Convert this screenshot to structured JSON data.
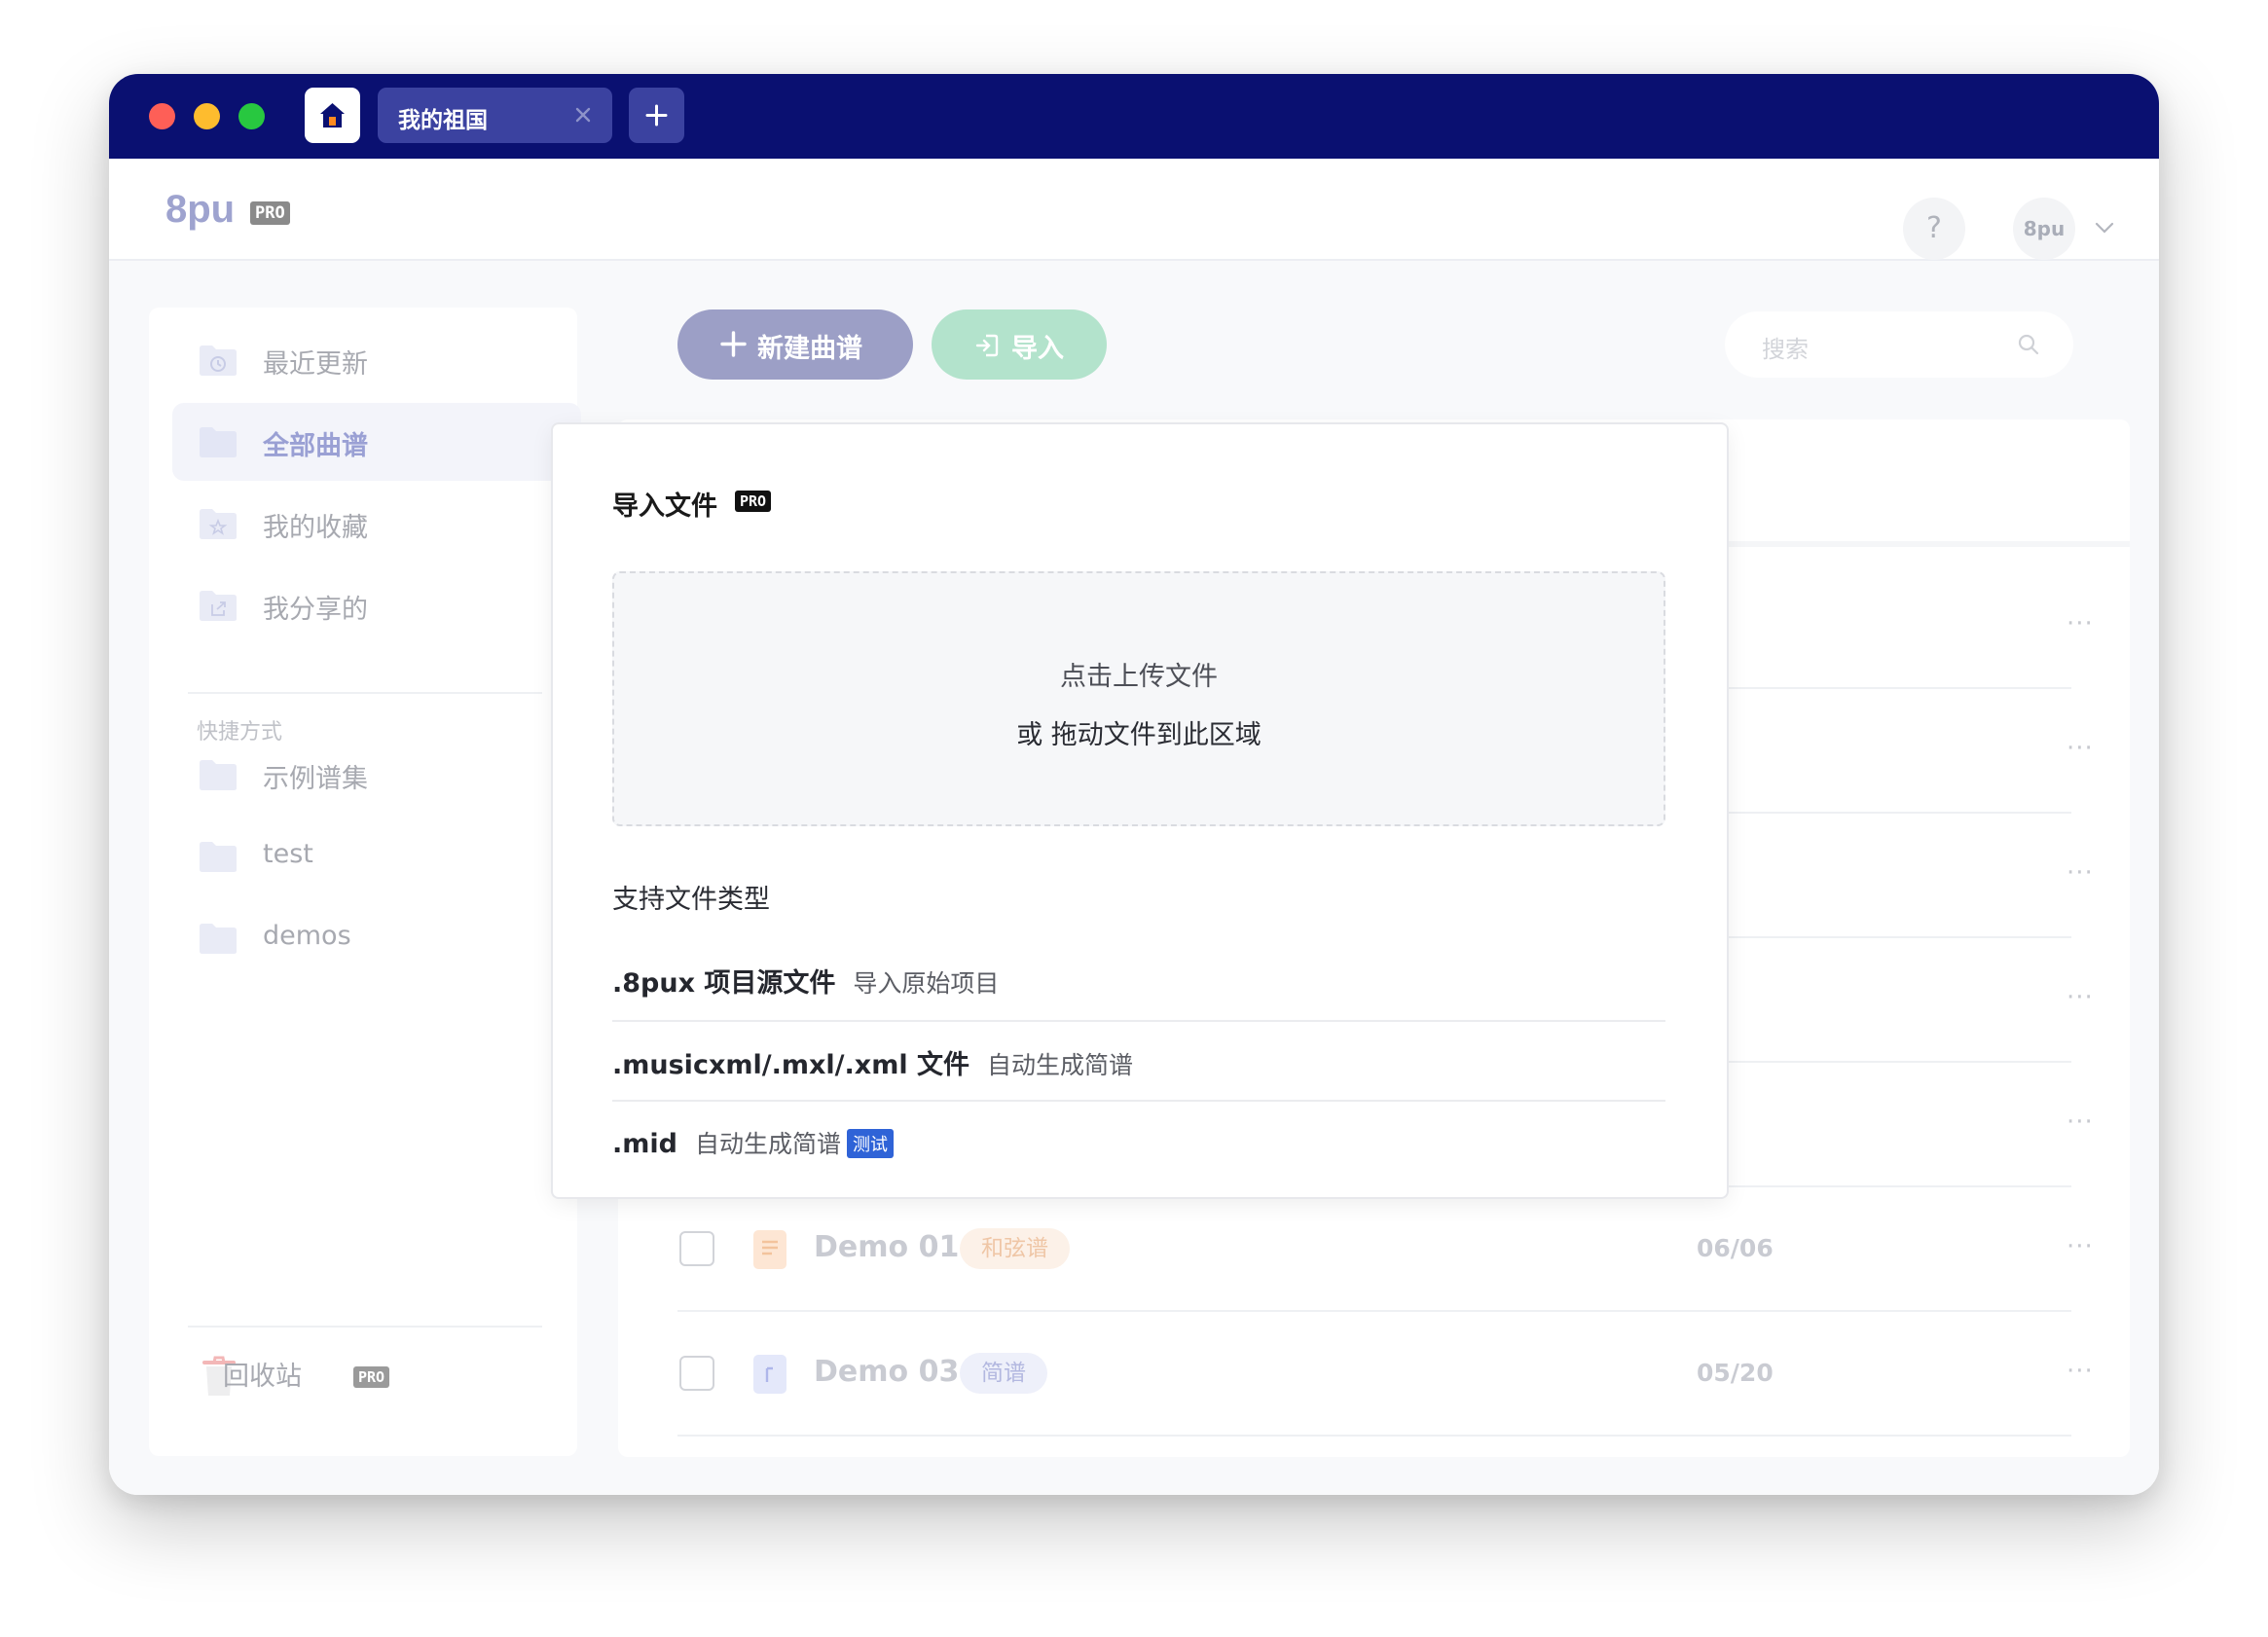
{
  "window": {
    "tabs": [
      {
        "label": "我的祖国"
      }
    ]
  },
  "header": {
    "logo": "8pu",
    "logo_badge": "PRO",
    "help_label": "?",
    "user_avatar": "8pu"
  },
  "sidebar": {
    "items": [
      {
        "label": "最近更新",
        "icon": "clock-folder-icon"
      },
      {
        "label": "全部曲谱",
        "icon": "folder-icon",
        "active": true
      },
      {
        "label": "我的收藏",
        "icon": "star-folder-icon"
      },
      {
        "label": "我分享的",
        "icon": "share-folder-icon"
      }
    ],
    "section_title": "快捷方式",
    "shortcuts": [
      {
        "label": "示例谱集"
      },
      {
        "label": "test"
      },
      {
        "label": "demos"
      }
    ],
    "trash": {
      "label": "回收站",
      "badge": "PRO"
    }
  },
  "toolbar": {
    "new_label": "新建曲谱",
    "import_label": "导入",
    "search_placeholder": "搜索"
  },
  "list": {
    "more_label": "···",
    "rows": [
      {
        "title": "Demo 01",
        "tag": "和弦谱",
        "date": "06/06"
      },
      {
        "title": "Demo 03",
        "tag": "简谱",
        "date": "05/20"
      }
    ]
  },
  "import_dialog": {
    "title": "导入文件",
    "title_badge": "PRO",
    "dropzone_line1": "点击上传文件",
    "dropzone_line2": "或 拖动文件到此区域",
    "support_title": "支持文件类型",
    "types": [
      {
        "name": ".8pux 项目源文件",
        "desc": "导入原始项目"
      },
      {
        "name": ".musicxml/.mxl/.xml 文件",
        "desc": "自动生成简谱"
      },
      {
        "name": ".mid",
        "desc": "自动生成简谱",
        "badge": "测试"
      }
    ]
  },
  "colors": {
    "titlebar": "#0a1071",
    "accent": "#9c9fc6",
    "import_green": "#b3e3cc",
    "badge_blue": "#2f63d7"
  }
}
